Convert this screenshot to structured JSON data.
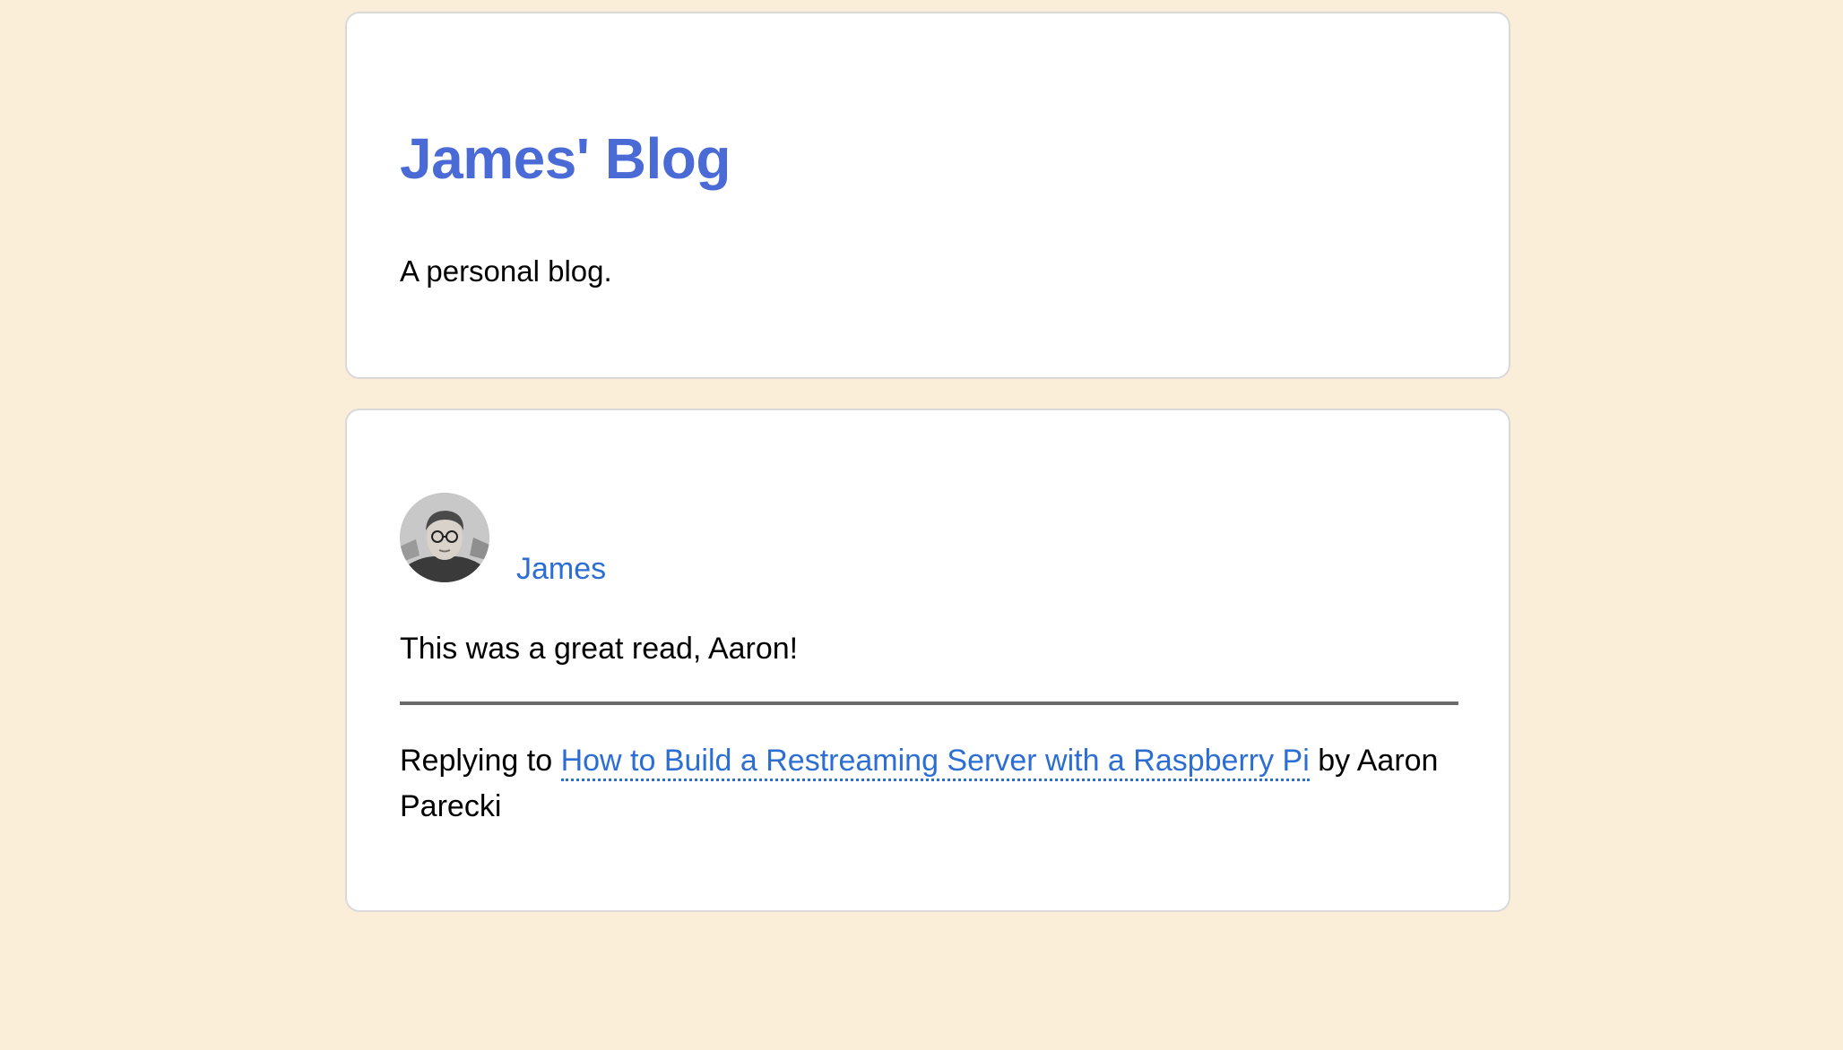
{
  "header": {
    "title": "James' Blog",
    "tagline": "A personal blog."
  },
  "post": {
    "author": {
      "name": "James",
      "avatar_icon": "author-avatar-photo"
    },
    "content": "This was a great read, Aaron!",
    "reply": {
      "prefix": "Replying to",
      "link_text": "How to Build a Restreaming Server with a Raspberry Pi",
      "by_text": "by Aaron Parecki"
    }
  },
  "colors": {
    "page_background": "#fbeed8",
    "title": "#4a6bd6",
    "link": "#2c6ed4",
    "divider": "#6b6b6b"
  }
}
